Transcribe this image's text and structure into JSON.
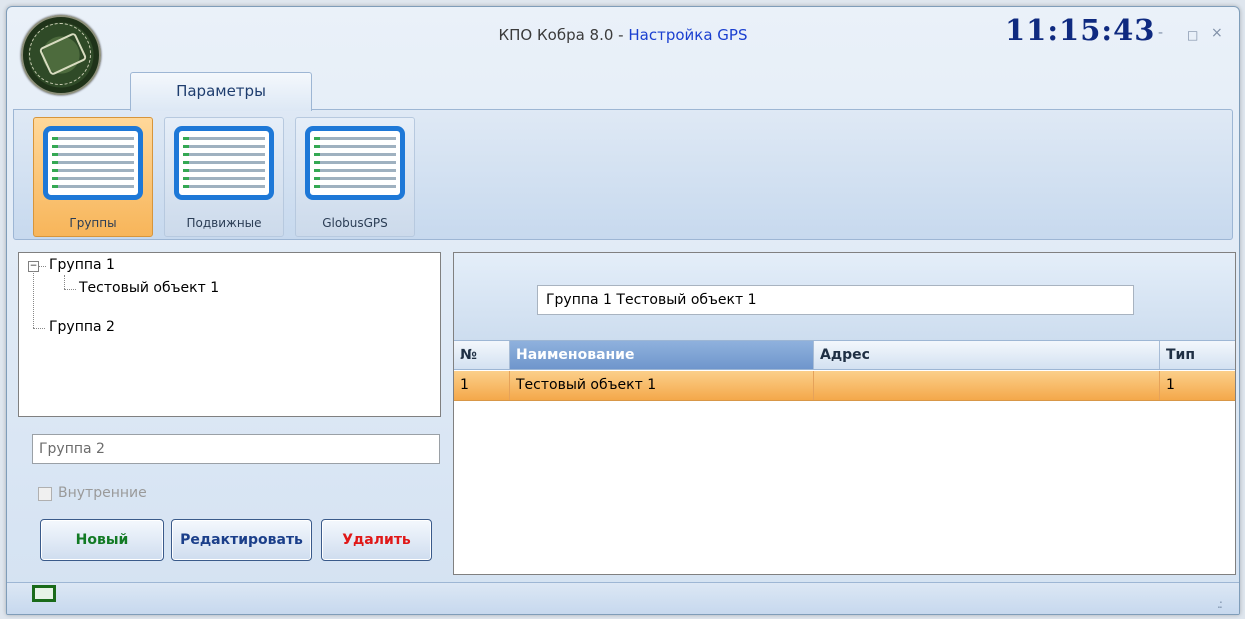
{
  "window": {
    "title_prefix": "КПО Кобра 8.0 - ",
    "title_accent": "Настройка GPS",
    "clock": "11:15:43",
    "min_glyph": "-",
    "max_glyph": "□",
    "close_glyph": "×"
  },
  "ribbon": {
    "tab_label": "Параметры",
    "buttons": [
      {
        "label": "Группы",
        "active": true
      },
      {
        "label": "Подвижные",
        "active": false
      },
      {
        "label": "GlobusGPS",
        "active": false
      }
    ]
  },
  "tree": {
    "expander_glyph": "−",
    "nodes": [
      {
        "label": "Группа 1",
        "level": 0,
        "expanded": true
      },
      {
        "label": "Тестовый объект 1",
        "level": 1
      },
      {
        "label": "Группа 2",
        "level": 0
      }
    ]
  },
  "left_form": {
    "name_value": "Группа 2",
    "checkbox_label": "Внутренние",
    "checkbox_checked": false,
    "btn_new": "Новый",
    "btn_edit": "Редактировать",
    "btn_delete": "Удалить"
  },
  "right": {
    "path_value": "Группа 1 Тестовый объект 1",
    "columns": [
      "№",
      "Наименование",
      "Адрес",
      "Тип"
    ],
    "rows": [
      [
        "1",
        "Тестовый объект 1",
        "",
        "1"
      ]
    ]
  },
  "status": {
    "grip_glyph": ".:"
  },
  "colors": {
    "accent_title": "#1a3fd0",
    "clock": "#0f2a80",
    "row_selected": "#f4a84a",
    "btn_new": "#127a24",
    "btn_edit": "#1b3f8a",
    "btn_delete": "#e01818"
  }
}
